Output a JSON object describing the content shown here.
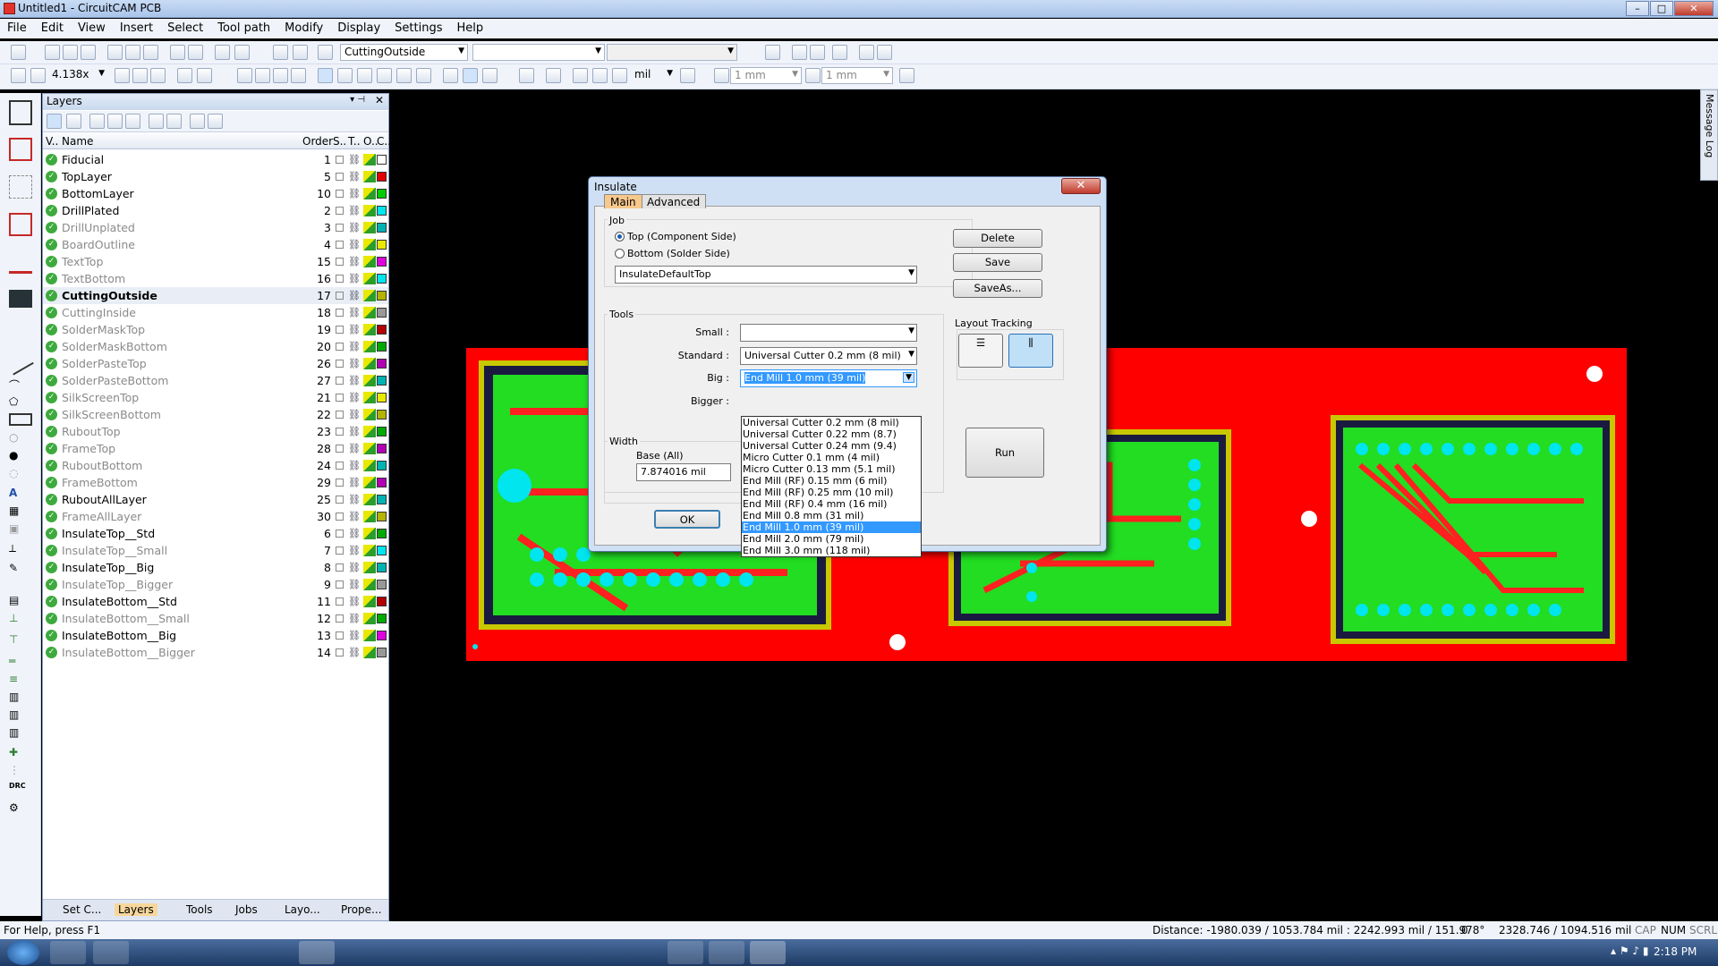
{
  "window": {
    "title": "Untitled1 - CircuitCAM PCB",
    "min_label": "–",
    "max_label": "□",
    "close_label": "✕"
  },
  "menu": [
    "File",
    "Edit",
    "View",
    "Insert",
    "Select",
    "Tool path",
    "Modify",
    "Display",
    "Settings",
    "Help"
  ],
  "toolbar": {
    "layer_combo": "CuttingOutside",
    "zoom": "4.138x",
    "unit": "mil",
    "grid1": "1 mm",
    "grid2": "1 mm"
  },
  "layers_panel": {
    "title": "Layers",
    "columns": [
      "V..",
      "Name",
      "Order",
      "S..",
      "T..",
      "O..",
      "C.."
    ],
    "rows": [
      {
        "name": "Fiducial",
        "order": "1",
        "color": "#ffffff",
        "bold": false,
        "dim": false
      },
      {
        "name": "TopLayer",
        "order": "5",
        "color": "#e00000",
        "bold": false,
        "dim": false
      },
      {
        "name": "BottomLayer",
        "order": "10",
        "color": "#00cc00",
        "bold": false,
        "dim": false
      },
      {
        "name": "DrillPlated",
        "order": "2",
        "color": "#00e5ee",
        "bold": false,
        "dim": false
      },
      {
        "name": "DrillUnplated",
        "order": "3",
        "color": "#00b3b3",
        "bold": false,
        "dim": true
      },
      {
        "name": "BoardOutline",
        "order": "4",
        "color": "#e8e800",
        "bold": false,
        "dim": true
      },
      {
        "name": "TextTop",
        "order": "15",
        "color": "#e000e0",
        "bold": false,
        "dim": true
      },
      {
        "name": "TextBottom",
        "order": "16",
        "color": "#00e5ee",
        "bold": false,
        "dim": true
      },
      {
        "name": "CuttingOutside",
        "order": "17",
        "color": "#b3b300",
        "bold": true,
        "dim": false
      },
      {
        "name": "CuttingInside",
        "order": "18",
        "color": "#999999",
        "bold": false,
        "dim": true
      },
      {
        "name": "SolderMaskTop",
        "order": "19",
        "color": "#b30000",
        "bold": false,
        "dim": true
      },
      {
        "name": "SolderMaskBottom",
        "order": "20",
        "color": "#00aa00",
        "bold": false,
        "dim": true
      },
      {
        "name": "SolderPasteTop",
        "order": "26",
        "color": "#b300b3",
        "bold": false,
        "dim": true
      },
      {
        "name": "SolderPasteBottom",
        "order": "27",
        "color": "#00b3b3",
        "bold": false,
        "dim": true
      },
      {
        "name": "SilkScreenTop",
        "order": "21",
        "color": "#e8e800",
        "bold": false,
        "dim": true
      },
      {
        "name": "SilkScreenBottom",
        "order": "22",
        "color": "#b3b300",
        "bold": false,
        "dim": true
      },
      {
        "name": "RuboutTop",
        "order": "23",
        "color": "#00aa00",
        "bold": false,
        "dim": true
      },
      {
        "name": "FrameTop",
        "order": "28",
        "color": "#b300b3",
        "bold": false,
        "dim": true
      },
      {
        "name": "RuboutBottom",
        "order": "24",
        "color": "#00b3b3",
        "bold": false,
        "dim": true
      },
      {
        "name": "FrameBottom",
        "order": "29",
        "color": "#b300b3",
        "bold": false,
        "dim": true
      },
      {
        "name": "RuboutAllLayer",
        "order": "25",
        "color": "#00b3b3",
        "bold": false,
        "dim": false
      },
      {
        "name": "FrameAllLayer",
        "order": "30",
        "color": "#b3b300",
        "bold": false,
        "dim": true
      },
      {
        "name": "InsulateTop__Std",
        "order": "6",
        "color": "#00aa00",
        "bold": false,
        "dim": false
      },
      {
        "name": "InsulateTop__Small",
        "order": "7",
        "color": "#00e5ee",
        "bold": false,
        "dim": true
      },
      {
        "name": "InsulateTop__Big",
        "order": "8",
        "color": "#00b3b3",
        "bold": false,
        "dim": false
      },
      {
        "name": "InsulateTop__Bigger",
        "order": "9",
        "color": "#999999",
        "bold": false,
        "dim": true
      },
      {
        "name": "InsulateBottom__Std",
        "order": "11",
        "color": "#b30000",
        "bold": false,
        "dim": false
      },
      {
        "name": "InsulateBottom__Small",
        "order": "12",
        "color": "#00aa00",
        "bold": false,
        "dim": true
      },
      {
        "name": "InsulateBottom__Big",
        "order": "13",
        "color": "#e000e0",
        "bold": false,
        "dim": false
      },
      {
        "name": "InsulateBottom__Bigger",
        "order": "14",
        "color": "#999999",
        "bold": false,
        "dim": true
      }
    ],
    "tabs": [
      "Set C...",
      "Layers",
      "Tools",
      "Jobs",
      "Layo...",
      "Prope..."
    ]
  },
  "side_panel": {
    "label": "Message Log"
  },
  "dialog": {
    "title": "Insulate",
    "close": "✕",
    "tabs": [
      "Main",
      "Advanced"
    ],
    "job_label": "Job",
    "radio_top": "Top (Component Side)",
    "radio_bottom": "Bottom (Solder Side)",
    "job_combo": "InsulateDefaultTop",
    "delete": "Delete",
    "save": "Save",
    "saveas": "SaveAs...",
    "tools_label": "Tools",
    "small_label": "Small :",
    "small_value": "",
    "standard_label": "Standard :",
    "standard_value": "Universal Cutter 0.2 mm (8 mil)",
    "big_label": "Big :",
    "big_value": "End Mill 1.0 mm (39 mil)",
    "bigger_label": "Bigger :",
    "layout_tracking": "Layout Tracking",
    "width_label": "Width",
    "base_label": "Base (All)",
    "base_value": "7.874016 mil",
    "ok": "OK",
    "run": "Run",
    "dropdown": [
      "Universal Cutter 0.2 mm (8 mil)",
      "Universal Cutter 0.22 mm (8.7)",
      "Universal Cutter 0.24 mm (9.4)",
      "Micro Cutter 0.1 mm (4 mil)",
      "Micro Cutter 0.13 mm (5.1 mil)",
      "End Mill (RF) 0.15 mm (6 mil)",
      "End Mill (RF) 0.25 mm (10 mil)",
      "End Mill (RF) 0.4 mm (16 mil)",
      "End Mill 0.8 mm (31 mil)",
      "End Mill 1.0 mm (39 mil)",
      "End Mill 2.0 mm (79 mil)",
      "End Mill 3.0 mm (118 mil)"
    ],
    "dropdown_selected": "End Mill 1.0 mm (39 mil)"
  },
  "status": {
    "help": "For Help, press F1",
    "distance": "Distance: -1980.039 / 1053.784 mil : 2242.993 mil / 151.978°",
    "zero": "0",
    "coords": "2328.746 / 1094.516 mil",
    "cap": "CAP",
    "num": "NUM",
    "scrl": "SCRL"
  },
  "taskbar": {
    "clock": "2:18 PM"
  },
  "colors": {
    "board": "#ff0000",
    "copper": "#22dd22",
    "pad": "#00e5ee",
    "track": "#ff2020",
    "outline": "#c8c800"
  }
}
